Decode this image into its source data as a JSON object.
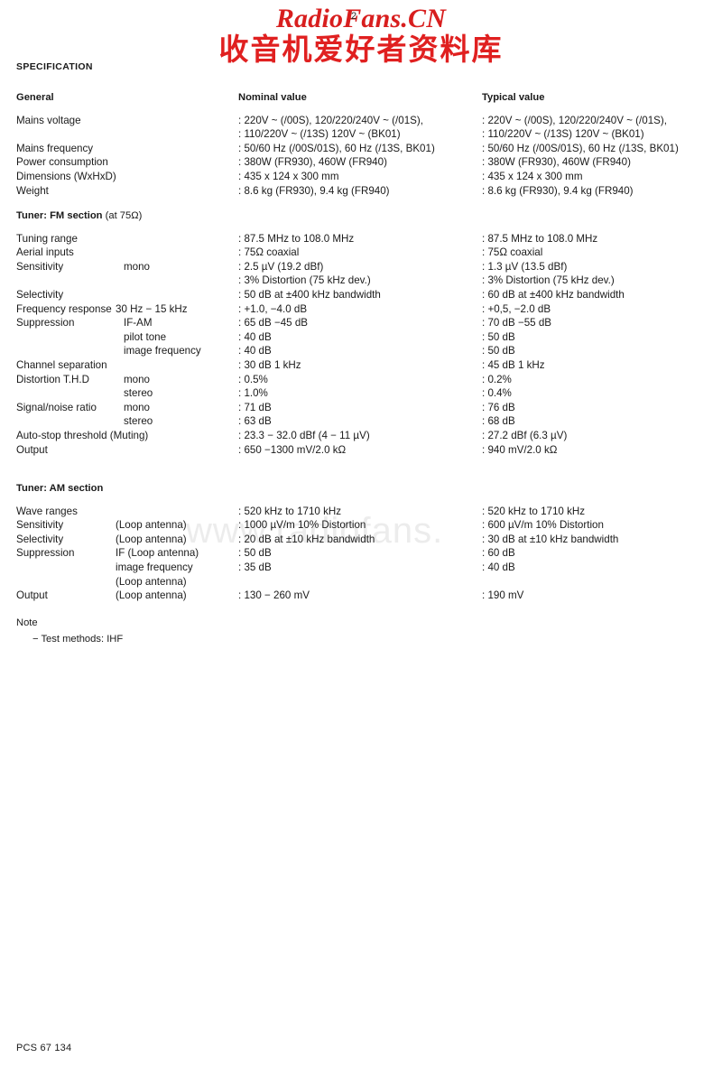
{
  "watermark": {
    "latin": "RadioFans.CN",
    "cjk": "收音机爱好者资料库",
    "ghost": "www.radiofans.",
    "latin_color": "#d81e1e",
    "cjk_color": "#e02020"
  },
  "page_number": "2",
  "document": {
    "title": "SPECIFICATION",
    "footer_code": "PCS 67 134"
  },
  "columns": {
    "label": "General",
    "nominal": "Nominal value",
    "typical": "Typical value"
  },
  "general": {
    "rows": [
      {
        "label": "Mains voltage",
        "sub": "",
        "nominal": ": 220V ~ (/00S), 120/220/240V ~ (/01S),",
        "typical": ": 220V ~ (/00S), 120/220/240V ~ (/01S),"
      },
      {
        "label": "",
        "sub": "",
        "nominal": ": 110/220V ~ (/13S)  120V ~ (BK01)",
        "typical": ": 110/220V ~ (/13S)  120V ~ (BK01)"
      },
      {
        "label": "Mains frequency",
        "sub": "",
        "nominal": ": 50/60 Hz (/00S/01S), 60 Hz (/13S, BK01)",
        "typical": ": 50/60 Hz (/00S/01S), 60 Hz (/13S, BK01)"
      },
      {
        "label": "Power consumption",
        "sub": "",
        "nominal": ": 380W (FR930), 460W (FR940)",
        "typical": ": 380W (FR930), 460W (FR940)"
      },
      {
        "label": "Dimensions (WxHxD)",
        "sub": "",
        "nominal": ": 435 x 124 x 300 mm",
        "typical": ": 435 x 124 x 300 mm"
      },
      {
        "label": "Weight",
        "sub": "",
        "nominal": ": 8.6 kg (FR930), 9.4 kg (FR940)",
        "typical": ": 8.6 kg (FR930), 9.4 kg (FR940)"
      }
    ]
  },
  "fm": {
    "header_bold": "Tuner:  FM section",
    "header_thin": " (at 75Ω)",
    "rows": [
      {
        "label": "Tuning range",
        "sub": "",
        "nominal": ": 87.5 MHz to 108.0 MHz",
        "typical": ": 87.5 MHz to 108.0 MHz"
      },
      {
        "label": "Aerial inputs",
        "sub": "",
        "nominal": ": 75Ω coaxial",
        "typical": ": 75Ω coaxial"
      },
      {
        "label": "Sensitivity",
        "sub": "mono",
        "nominal": ": 2.5 µV (19.2 dBf)",
        "typical": ": 1.3 µV (13.5 dBf)"
      },
      {
        "label": "",
        "sub": "",
        "nominal": ": 3% Distortion (75 kHz dev.)",
        "typical": ": 3% Distortion (75 kHz dev.)"
      },
      {
        "label": "Selectivity",
        "sub": "",
        "nominal": ": 50 dB at ±400 kHz bandwidth",
        "typical": ": 60 dB at ±400 kHz bandwidth"
      },
      {
        "label": "Frequency response",
        "sub": "30 Hz − 15 kHz",
        "sub_wide": true,
        "nominal": ": +1.0, −4.0 dB",
        "typical": ": +0,5, −2.0 dB"
      },
      {
        "label": "Suppression",
        "sub": "IF-AM",
        "nominal": ": 65 dB −45 dB",
        "typical": ": 70 dB −55 dB"
      },
      {
        "label": "",
        "sub": "pilot tone",
        "nominal": ": 40 dB",
        "typical": ": 50 dB"
      },
      {
        "label": "",
        "sub": "image frequency",
        "nominal": ": 40 dB",
        "typical": ": 50 dB"
      },
      {
        "label": "Channel separation",
        "sub": "",
        "nominal": ": 30 dB 1 kHz",
        "typical": ": 45 dB 1 kHz"
      },
      {
        "label": "Distortion T.H.D",
        "sub": "mono",
        "nominal": ": 0.5%",
        "typical": ": 0.2%"
      },
      {
        "label": "",
        "sub": "stereo",
        "nominal": ": 1.0%",
        "typical": ": 0.4%"
      },
      {
        "label": "Signal/noise ratio",
        "sub": "mono",
        "nominal": ": 71 dB",
        "typical": ": 76 dB"
      },
      {
        "label": "",
        "sub": "stereo",
        "nominal": ": 63 dB",
        "typical": ": 68 dB"
      },
      {
        "label": "Auto-stop threshold (Muting)",
        "sub": "",
        "nominal": ": 23.3 − 32.0 dBf (4 − 11 µV)",
        "typical": ": 27.2 dBf (6.3 µV)"
      },
      {
        "label": "Output",
        "sub": "",
        "nominal": ": 650 −1300 mV/2.0 kΩ",
        "typical": ": 940 mV/2.0 kΩ"
      }
    ]
  },
  "am": {
    "header_bold": "Tuner:  AM section",
    "header_thin": "",
    "rows": [
      {
        "label": "Wave ranges",
        "sub": "",
        "nominal": ": 520 kHz to 1710 kHz",
        "typical": ": 520 kHz to 1710 kHz"
      },
      {
        "label": "Sensitivity",
        "sub": "(Loop antenna)",
        "sub_wide": true,
        "nominal": ": 1000 µV/m 10% Distortion",
        "typical": ": 600 µV/m 10% Distortion"
      },
      {
        "label": "Selectivity",
        "sub": "(Loop antenna)",
        "sub_wide": true,
        "nominal": ": 20 dB at ±10 kHz bandwidth",
        "typical": ": 30 dB at ±10 kHz bandwidth"
      },
      {
        "label": "Suppression",
        "sub": "IF (Loop antenna)",
        "sub_wide": true,
        "nominal": ": 50 dB",
        "typical": ": 60 dB"
      },
      {
        "label": "",
        "sub": "image frequency",
        "sub_wide": true,
        "nominal": ": 35 dB",
        "typical": ": 40 dB"
      },
      {
        "label": "",
        "sub": "(Loop antenna)",
        "sub_wide": true,
        "nominal": "",
        "typical": ""
      },
      {
        "label": "Output",
        "sub": "(Loop antenna)",
        "sub_wide": true,
        "nominal": ": 130 − 260 mV",
        "typical": ": 190 mV"
      }
    ]
  },
  "note": {
    "title": "Note",
    "items": [
      "−  Test methods: IHF"
    ]
  }
}
